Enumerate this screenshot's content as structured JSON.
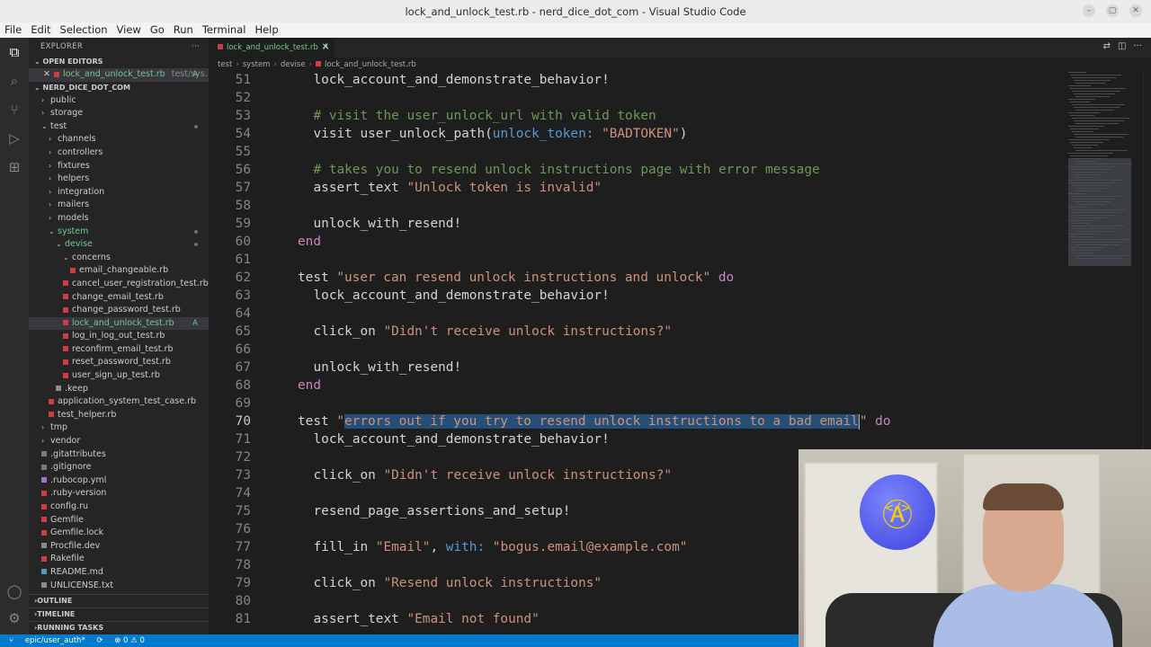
{
  "window": {
    "title": "lock_and_unlock_test.rb - nerd_dice_dot_com - Visual Studio Code"
  },
  "menu": [
    "File",
    "Edit",
    "Selection",
    "View",
    "Go",
    "Run",
    "Terminal",
    "Help"
  ],
  "activity_bar": [
    "files-icon",
    "search-icon",
    "source-control-icon",
    "run-debug-icon",
    "extensions-icon",
    "account-icon",
    "settings-icon"
  ],
  "sidebar": {
    "title": "EXPLORER",
    "open_editors_label": "OPEN EDITORS",
    "open_editor": {
      "name": "lock_and_unlock_test.rb",
      "path": "test/sys...",
      "badge": "A"
    },
    "project_label": "NERD_DICE_DOT_COM",
    "tree": [
      {
        "label": "public",
        "type": "folder",
        "depth": 1
      },
      {
        "label": "storage",
        "type": "folder",
        "depth": 1
      },
      {
        "label": "test",
        "type": "folder-open",
        "depth": 1,
        "dot": true
      },
      {
        "label": "channels",
        "type": "folder",
        "depth": 2
      },
      {
        "label": "controllers",
        "type": "folder",
        "depth": 2
      },
      {
        "label": "fixtures",
        "type": "folder",
        "depth": 2
      },
      {
        "label": "helpers",
        "type": "folder",
        "depth": 2
      },
      {
        "label": "integration",
        "type": "folder",
        "depth": 2
      },
      {
        "label": "mailers",
        "type": "folder",
        "depth": 2
      },
      {
        "label": "models",
        "type": "folder",
        "depth": 2
      },
      {
        "label": "system",
        "type": "folder-open",
        "depth": 2,
        "dot": true,
        "green": true
      },
      {
        "label": "devise",
        "type": "folder-open",
        "depth": 3,
        "dot": true,
        "green": true
      },
      {
        "label": "concerns",
        "type": "folder-open",
        "depth": 4
      },
      {
        "label": "email_changeable.rb",
        "type": "ruby",
        "depth": 5
      },
      {
        "label": "cancel_user_registration_test.rb",
        "type": "ruby",
        "depth": 4
      },
      {
        "label": "change_email_test.rb",
        "type": "ruby",
        "depth": 4
      },
      {
        "label": "change_password_test.rb",
        "type": "ruby",
        "depth": 4
      },
      {
        "label": "lock_and_unlock_test.rb",
        "type": "ruby",
        "depth": 4,
        "badge": "A",
        "selected": true,
        "green": true
      },
      {
        "label": "log_in_log_out_test.rb",
        "type": "ruby",
        "depth": 4
      },
      {
        "label": "reconfirm_email_test.rb",
        "type": "ruby",
        "depth": 4
      },
      {
        "label": "reset_password_test.rb",
        "type": "ruby",
        "depth": 4
      },
      {
        "label": "user_sign_up_test.rb",
        "type": "ruby",
        "depth": 4
      },
      {
        "label": ".keep",
        "type": "txt",
        "depth": 3
      },
      {
        "label": "application_system_test_case.rb",
        "type": "ruby",
        "depth": 2
      },
      {
        "label": "test_helper.rb",
        "type": "ruby",
        "depth": 2
      },
      {
        "label": "tmp",
        "type": "folder",
        "depth": 1
      },
      {
        "label": "vendor",
        "type": "folder",
        "depth": 1
      },
      {
        "label": ".gitattributes",
        "type": "git",
        "depth": 1
      },
      {
        "label": ".gitignore",
        "type": "git",
        "depth": 1
      },
      {
        "label": ".rubocop.yml",
        "type": "yml",
        "depth": 1
      },
      {
        "label": ".ruby-version",
        "type": "ruby",
        "depth": 1
      },
      {
        "label": "config.ru",
        "type": "ruby",
        "depth": 1
      },
      {
        "label": "Gemfile",
        "type": "ruby",
        "depth": 1
      },
      {
        "label": "Gemfile.lock",
        "type": "ruby",
        "depth": 1
      },
      {
        "label": "Procfile.dev",
        "type": "txt",
        "depth": 1
      },
      {
        "label": "Rakefile",
        "type": "ruby",
        "depth": 1
      },
      {
        "label": "README.md",
        "type": "md",
        "depth": 1
      },
      {
        "label": "UNLICENSE.txt",
        "type": "txt",
        "depth": 1
      }
    ],
    "outline_label": "OUTLINE",
    "timeline_label": "TIMELINE",
    "running_tasks_label": "RUNNING TASKS"
  },
  "tab": {
    "label": "lock_and_unlock_test.rb",
    "badge": "A"
  },
  "breadcrumb": [
    "test",
    "system",
    "devise",
    "lock_and_unlock_test.rb"
  ],
  "code": [
    {
      "n": "51",
      "i": 2,
      "t": [
        [
          "m",
          "lock_account_and_demonstrate_behavior!"
        ]
      ]
    },
    {
      "n": "52",
      "i": 0,
      "t": []
    },
    {
      "n": "53",
      "i": 2,
      "t": [
        [
          "c",
          "# visit the user_unlock_url with valid token"
        ]
      ]
    },
    {
      "n": "54",
      "i": 2,
      "t": [
        [
          "p",
          "visit user_unlock_path("
        ],
        [
          "y",
          "unlock_token:"
        ],
        [
          "p",
          " "
        ],
        [
          "s",
          "\"BADTOKEN\""
        ],
        [
          "p",
          ")"
        ]
      ]
    },
    {
      "n": "55",
      "i": 0,
      "t": []
    },
    {
      "n": "56",
      "i": 2,
      "t": [
        [
          "c",
          "# takes you to resend unlock instructions page with error message"
        ]
      ]
    },
    {
      "n": "57",
      "i": 2,
      "t": [
        [
          "p",
          "assert_text "
        ],
        [
          "s",
          "\"Unlock token is invalid\""
        ]
      ]
    },
    {
      "n": "58",
      "i": 0,
      "t": []
    },
    {
      "n": "59",
      "i": 2,
      "t": [
        [
          "p",
          "unlock_with_resend!"
        ]
      ]
    },
    {
      "n": "60",
      "i": 1,
      "t": [
        [
          "k",
          "end"
        ]
      ]
    },
    {
      "n": "61",
      "i": 0,
      "t": []
    },
    {
      "n": "62",
      "i": 1,
      "t": [
        [
          "p",
          "test "
        ],
        [
          "s",
          "\"user can resend unlock instructions and unlock\""
        ],
        [
          "p",
          " "
        ],
        [
          "k",
          "do"
        ]
      ]
    },
    {
      "n": "63",
      "i": 2,
      "t": [
        [
          "p",
          "lock_account_and_demonstrate_behavior!"
        ]
      ]
    },
    {
      "n": "64",
      "i": 0,
      "t": []
    },
    {
      "n": "65",
      "i": 2,
      "t": [
        [
          "p",
          "click_on "
        ],
        [
          "s",
          "\"Didn't receive unlock instructions?\""
        ]
      ]
    },
    {
      "n": "66",
      "i": 0,
      "t": []
    },
    {
      "n": "67",
      "i": 2,
      "t": [
        [
          "p",
          "unlock_with_resend!"
        ]
      ]
    },
    {
      "n": "68",
      "i": 1,
      "t": [
        [
          "k",
          "end"
        ]
      ]
    },
    {
      "n": "69",
      "i": 0,
      "t": []
    },
    {
      "n": "70",
      "i": 1,
      "active": true,
      "t": [
        [
          "p",
          "test "
        ],
        [
          "s",
          "\""
        ],
        [
          "x",
          "errors out if you try to resend unlock instructions to a bad email"
        ],
        [
          "cur",
          ""
        ],
        [
          "s",
          "\""
        ],
        [
          "p",
          " "
        ],
        [
          "k",
          "do"
        ]
      ]
    },
    {
      "n": "71",
      "i": 2,
      "t": [
        [
          "p",
          "lock_account_and_demonstrate_behavior!"
        ]
      ]
    },
    {
      "n": "72",
      "i": 0,
      "t": []
    },
    {
      "n": "73",
      "i": 2,
      "t": [
        [
          "p",
          "click_on "
        ],
        [
          "s",
          "\"Didn't receive unlock instructions?\""
        ]
      ]
    },
    {
      "n": "74",
      "i": 0,
      "t": []
    },
    {
      "n": "75",
      "i": 2,
      "t": [
        [
          "p",
          "resend_page_assertions_and_setup!"
        ]
      ]
    },
    {
      "n": "76",
      "i": 0,
      "t": []
    },
    {
      "n": "77",
      "i": 2,
      "t": [
        [
          "p",
          "fill_in "
        ],
        [
          "s",
          "\"Email\""
        ],
        [
          "p",
          ", "
        ],
        [
          "y",
          "with:"
        ],
        [
          "p",
          " "
        ],
        [
          "s",
          "\"bogus.email@example.com\""
        ]
      ]
    },
    {
      "n": "78",
      "i": 0,
      "t": []
    },
    {
      "n": "79",
      "i": 2,
      "t": [
        [
          "p",
          "click_on "
        ],
        [
          "s",
          "\"Resend unlock instructions\""
        ]
      ]
    },
    {
      "n": "80",
      "i": 0,
      "t": []
    },
    {
      "n": "81",
      "i": 2,
      "t": [
        [
          "p",
          "assert_text "
        ],
        [
          "s",
          "\"Email not found\""
        ]
      ]
    }
  ],
  "statusbar": {
    "branch": "epic/user_auth*",
    "sync": "⟳",
    "problems": "⊗ 0 ⚠ 0"
  },
  "webcam": {
    "logo_glyph": "Ⓐ",
    "logo_code": "</>"
  }
}
